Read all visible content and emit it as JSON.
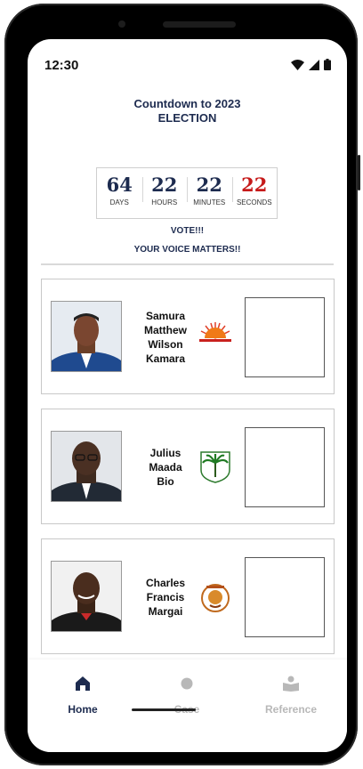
{
  "status_bar": {
    "time": "12:30"
  },
  "header": {
    "title_line1": "Countdown to 2023",
    "title_line2": "ELECTION"
  },
  "countdown": [
    {
      "value": "64",
      "label": "DAYS"
    },
    {
      "value": "22",
      "label": "HOURS"
    },
    {
      "value": "22",
      "label": "MINUTES"
    },
    {
      "value": "22",
      "label": "SECONDS"
    }
  ],
  "messages": {
    "vote": "VOTE!!!",
    "voice": "YOUR VOICE MATTERS!!"
  },
  "candidates": [
    {
      "name_lines": [
        "Samura",
        "Matthew",
        "Wilson",
        "Kamara"
      ],
      "party_logo": "apc-rising-sun-icon"
    },
    {
      "name_lines": [
        "Julius",
        "Maada",
        "Bio"
      ],
      "party_logo": "slpp-palm-tree-icon"
    },
    {
      "name_lines": [
        "Charles",
        "Francis",
        "Margai"
      ],
      "party_logo": "pmdc-emblem-icon"
    }
  ],
  "nav": {
    "home": "Home",
    "case": "Case",
    "reference": "Reference"
  },
  "colors": {
    "primary": "#1d2b4f",
    "seconds": "#c61a1a",
    "inactive": "#b8b8b8"
  }
}
